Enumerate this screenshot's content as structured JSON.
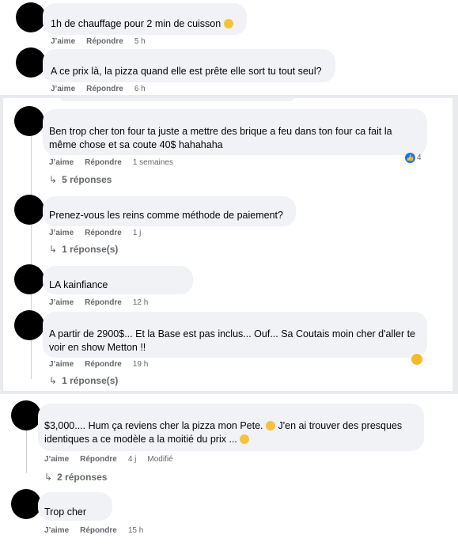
{
  "comments": [
    {
      "text": "1h de chauffage pour 2 min de cuisson",
      "like": "J’aime",
      "reply": "Répondre",
      "time": "5 h"
    },
    {
      "text": "A ce prix là, la pizza quand elle est prête elle sort tu tout seul?",
      "like": "J’aime",
      "reply": "Répondre",
      "time": "6 h"
    },
    {
      "text": "Ben trop cher ton four ta juste a mettre des brique a feu dans ton four ca fait la même chose et sa coute 40$ hahahaha",
      "like": "J’aime",
      "reply": "Répondre",
      "time": "1 semaines",
      "reaction_count": "4",
      "replies": "5 réponses"
    },
    {
      "text": "Prenez-vous les reins comme méthode de paiement?",
      "like": "J’aime",
      "reply": "Répondre",
      "time": "1 j",
      "replies": "1 réponse(s)"
    },
    {
      "text": "LA kainfiance",
      "like": "J’aime",
      "reply": "Répondre",
      "time": "12 h"
    },
    {
      "text": "A partir de 2900$... Et la Base est pas inclus... Ouf... Sa Coutais moin cher d'aller te voir en show Metton !!",
      "like": "J’aime",
      "reply": "Répondre",
      "time": "19 h",
      "replies": "1 réponse(s)"
    },
    {
      "text": "$3,000.... Hum ça reviens cher la pizza mon Pete.",
      "text2": "J'en ai trouver des presques identiques a ce modèle a la moitié du prix ...",
      "like": "J’aime",
      "reply": "Répondre",
      "time": "4 j",
      "edited": "Modifié",
      "replies": "2 réponses"
    },
    {
      "text": "Trop cher",
      "like": "J’aime",
      "reply": "Répondre",
      "time": "15 h"
    }
  ],
  "colors": {
    "background": "#e9ebee",
    "bubble": "#f0f2f5",
    "meta_text": "#65676b",
    "like_blue": "#1877f2"
  },
  "icons": [
    "like-reaction-icon",
    "emoji-icon",
    "reply-arrow-icon"
  ]
}
